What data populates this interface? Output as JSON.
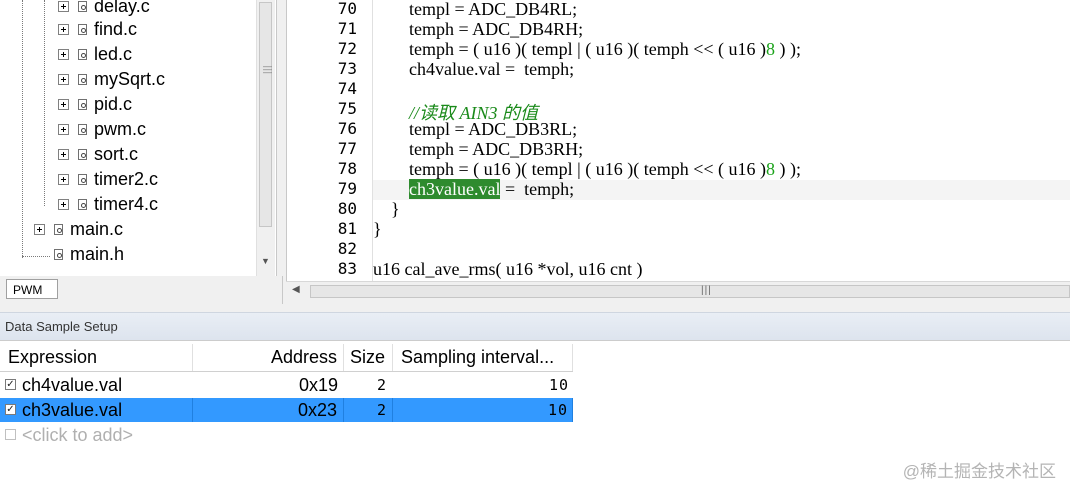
{
  "tree": {
    "items": [
      {
        "label": "delay.c"
      },
      {
        "label": "find.c"
      },
      {
        "label": "led.c"
      },
      {
        "label": "mySqrt.c"
      },
      {
        "label": "pid.c"
      },
      {
        "label": "pwm.c"
      },
      {
        "label": "sort.c"
      },
      {
        "label": "timer2.c"
      },
      {
        "label": "timer4.c"
      },
      {
        "label": "main.c"
      },
      {
        "label": "main.h"
      }
    ],
    "tab_label": "PWM"
  },
  "editor": {
    "lines": [
      {
        "num": "70",
        "segments": [
          {
            "t": "        templ = ADC_DB4RL;",
            "c": "txt"
          }
        ]
      },
      {
        "num": "71",
        "segments": [
          {
            "t": "        temph = ADC_DB4RH;",
            "c": "txt"
          }
        ]
      },
      {
        "num": "72",
        "segments": [
          {
            "t": "        temph = ( u16 )( templ | ( u16 )( temph << ( u16 )",
            "c": "txt"
          },
          {
            "t": "8",
            "c": "num"
          },
          {
            "t": " ) );",
            "c": "txt"
          }
        ]
      },
      {
        "num": "73",
        "segments": [
          {
            "t": "        ch4value.val =  temph;",
            "c": "txt"
          }
        ]
      },
      {
        "num": "74",
        "segments": [
          {
            "t": "",
            "c": "txt"
          }
        ]
      },
      {
        "num": "75",
        "segments": [
          {
            "t": "        //读取 AIN3 的值",
            "c": "cmt"
          }
        ]
      },
      {
        "num": "76",
        "segments": [
          {
            "t": "        templ = ADC_DB3RL;",
            "c": "txt"
          }
        ]
      },
      {
        "num": "77",
        "segments": [
          {
            "t": "        temph = ADC_DB3RH;",
            "c": "txt"
          }
        ]
      },
      {
        "num": "78",
        "segments": [
          {
            "t": "        temph = ( u16 )( templ | ( u16 )( temph << ( u16 )",
            "c": "txt"
          },
          {
            "t": "8",
            "c": "num"
          },
          {
            "t": " ) );",
            "c": "txt"
          }
        ]
      },
      {
        "num": "79",
        "segments": [
          {
            "t": "        ",
            "c": "txt"
          },
          {
            "t": "ch3value.val",
            "c": "sel"
          },
          {
            "t": " =  temph;",
            "c": "txt"
          }
        ]
      },
      {
        "num": "80",
        "segments": [
          {
            "t": "    }",
            "c": "txt"
          }
        ]
      },
      {
        "num": "81",
        "segments": [
          {
            "t": "}",
            "c": "txt"
          }
        ]
      },
      {
        "num": "82",
        "segments": [
          {
            "t": "",
            "c": "txt"
          }
        ]
      },
      {
        "num": "83",
        "segments": [
          {
            "t": "u16 cal_ave_rms( u16 *vol, u16 cnt )",
            "c": "txt"
          }
        ]
      }
    ]
  },
  "panel": {
    "title": "Data Sample Setup",
    "headers": {
      "expression": "Expression",
      "address": "Address",
      "size": "Size",
      "interval": "Sampling interval..."
    },
    "rows": [
      {
        "expression": "ch4value.val",
        "address": "0x19",
        "size": "2",
        "interval": "10",
        "checked": true
      },
      {
        "expression": "ch3value.val",
        "address": "0x23",
        "size": "2",
        "interval": "10",
        "checked": true
      }
    ],
    "add_placeholder": "<click to add>"
  },
  "watermark": "@稀土掘金技术社区",
  "colors": {
    "selection": "#3399ff",
    "code_highlight": "#2e8b2e",
    "number": "#1aa31a"
  }
}
